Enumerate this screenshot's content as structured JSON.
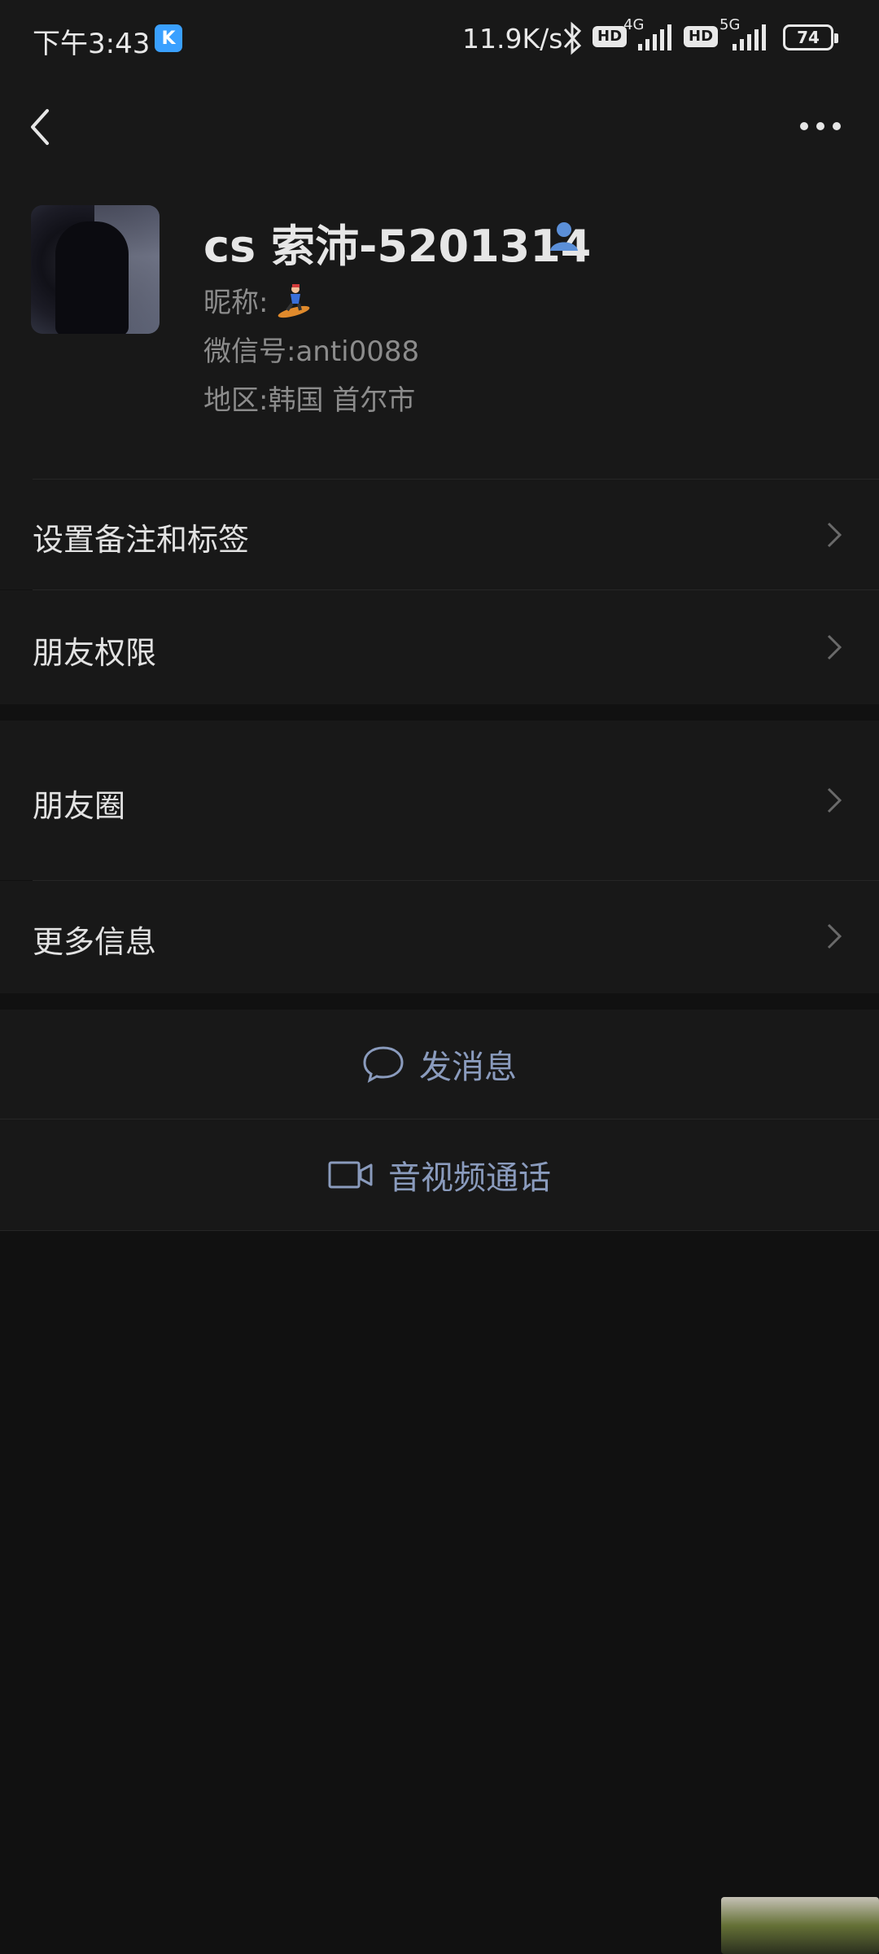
{
  "status_bar": {
    "time": "下午3:43",
    "app_badge": "K",
    "net_speed": "11.9K/s",
    "hd1": "HD",
    "net1": "4G",
    "hd2": "HD",
    "net2": "5G",
    "battery": "74"
  },
  "profile": {
    "display_name": "cs 索沛-5201314",
    "nickname_label": "昵称:",
    "wechat_id": "微信号:anti0088",
    "region": "地区:韩国  首尔市"
  },
  "menu": {
    "set_remark": "设置备注和标签",
    "friend_permissions": "朋友权限",
    "moments": "朋友圈",
    "more_info": "更多信息"
  },
  "actions": {
    "send_message": "发消息",
    "video_call": "音视频通话"
  },
  "colors": {
    "background": "#111111",
    "surface": "#181818",
    "action_text": "#8a9bbd",
    "contact_icon": "#5b8fd8"
  }
}
